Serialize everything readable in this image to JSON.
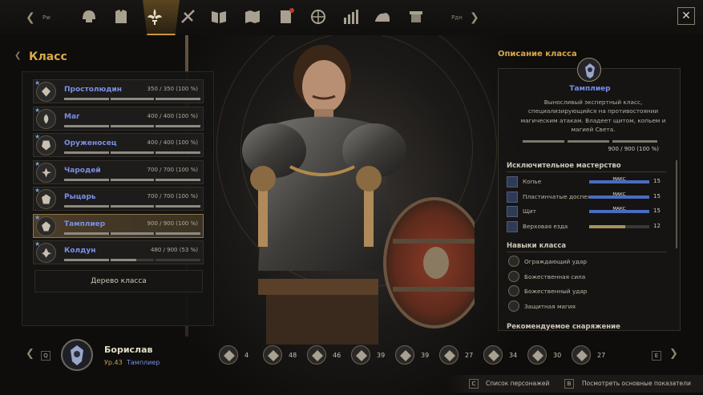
{
  "nav": {
    "prev_key": "Pw",
    "next_key": "Pдн",
    "icons": [
      "helmet-icon",
      "armor-icon",
      "class-fleur-icon",
      "skill-icon",
      "book-icon",
      "map-icon",
      "quest-icon",
      "compass-icon",
      "stats-icon",
      "mount-icon",
      "scroll-icon"
    ],
    "active_icon": "class-fleur-icon"
  },
  "left_panel": {
    "title": "Класс",
    "classes": [
      {
        "name": "Простолюдин",
        "exp": "350 / 350 (100 %)",
        "progress": 1.0
      },
      {
        "name": "Маг",
        "exp": "400 / 400 (100 %)",
        "progress": 1.0
      },
      {
        "name": "Оруженосец",
        "exp": "400 / 400 (100 %)",
        "progress": 1.0
      },
      {
        "name": "Чародей",
        "exp": "700 / 700 (100 %)",
        "progress": 1.0
      },
      {
        "name": "Рыцарь",
        "exp": "700 / 700 (100 %)",
        "progress": 1.0
      },
      {
        "name": "Тамплиер",
        "exp": "900 / 900 (100 %)",
        "progress": 1.0,
        "active": true
      },
      {
        "name": "Колдун",
        "exp": "480 / 900 (53 %)",
        "progress": 0.53
      }
    ],
    "tree_button": "Дерево класса"
  },
  "right_panel": {
    "title": "Описание класса",
    "class_name": "Тамплиер",
    "description": "Выносливый экспертный класс, специализирующийся на противостоянии магическим атакам. Владеет щитом, копьем и магией Света.",
    "exp": "900 / 900 (100 %)",
    "mastery_title": "Исключительное мастерство",
    "mastery": [
      {
        "name": "Копье",
        "max_label": "МАКС",
        "value": "15",
        "progress": 1.0
      },
      {
        "name": "Пластинчатые доспех",
        "max_label": "МАКС",
        "value": "15",
        "progress": 1.0
      },
      {
        "name": "Щит",
        "max_label": "МАКС",
        "value": "15",
        "progress": 1.0
      },
      {
        "name": "Верховая езда",
        "max_label": "",
        "value": "12",
        "progress": 0.6
      }
    ],
    "skills_title": "Навыки класса",
    "skills": [
      "Ограждающий удар",
      "Божественная сила",
      "Божественный удар",
      "Защитная магия"
    ],
    "equipment_title": "Рекомендуемое снаряжение"
  },
  "bottom": {
    "prev_key": "Q",
    "next_key": "E",
    "char_name": "Борислав",
    "char_level": "Ур.43",
    "char_class": "Тамплиер",
    "class_counts": [
      "4",
      "48",
      "46",
      "39",
      "39",
      "27",
      "34",
      "30",
      "27"
    ]
  },
  "hints": [
    {
      "key": "C",
      "label": "Список персонажей"
    },
    {
      "key": "B",
      "label": "Посмотреть основные показатели"
    }
  ],
  "colors": {
    "accent_gold": "#d9a84a",
    "class_blue": "#7b8fe6",
    "mastery_blue": "#4a6cc0"
  }
}
